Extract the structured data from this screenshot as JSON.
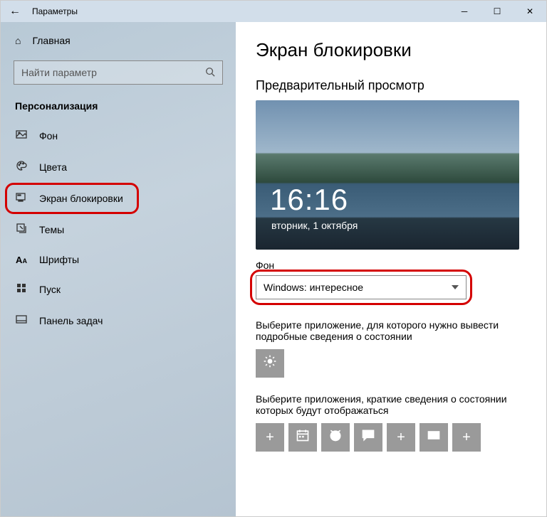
{
  "window": {
    "title": "Параметры"
  },
  "sidebar": {
    "home": "Главная",
    "search_placeholder": "Найти параметр",
    "section": "Персонализация",
    "items": [
      {
        "label": "Фон"
      },
      {
        "label": "Цвета"
      },
      {
        "label": "Экран блокировки"
      },
      {
        "label": "Темы"
      },
      {
        "label": "Шрифты"
      },
      {
        "label": "Пуск"
      },
      {
        "label": "Панель задач"
      }
    ]
  },
  "main": {
    "heading": "Экран блокировки",
    "preview_label": "Предварительный просмотр",
    "preview": {
      "time": "16:16",
      "date": "вторник, 1 октября"
    },
    "background_label": "Фон",
    "background_value": "Windows: интересное",
    "detailed_label": "Выберите приложение, для которого нужно вывести подробные сведения о состоянии",
    "quick_label": "Выберите приложения, краткие сведения о состоянии которых будут отображаться",
    "quick_tiles": [
      "plus",
      "calendar",
      "alarm",
      "chat",
      "plus",
      "mail",
      "plus"
    ]
  }
}
